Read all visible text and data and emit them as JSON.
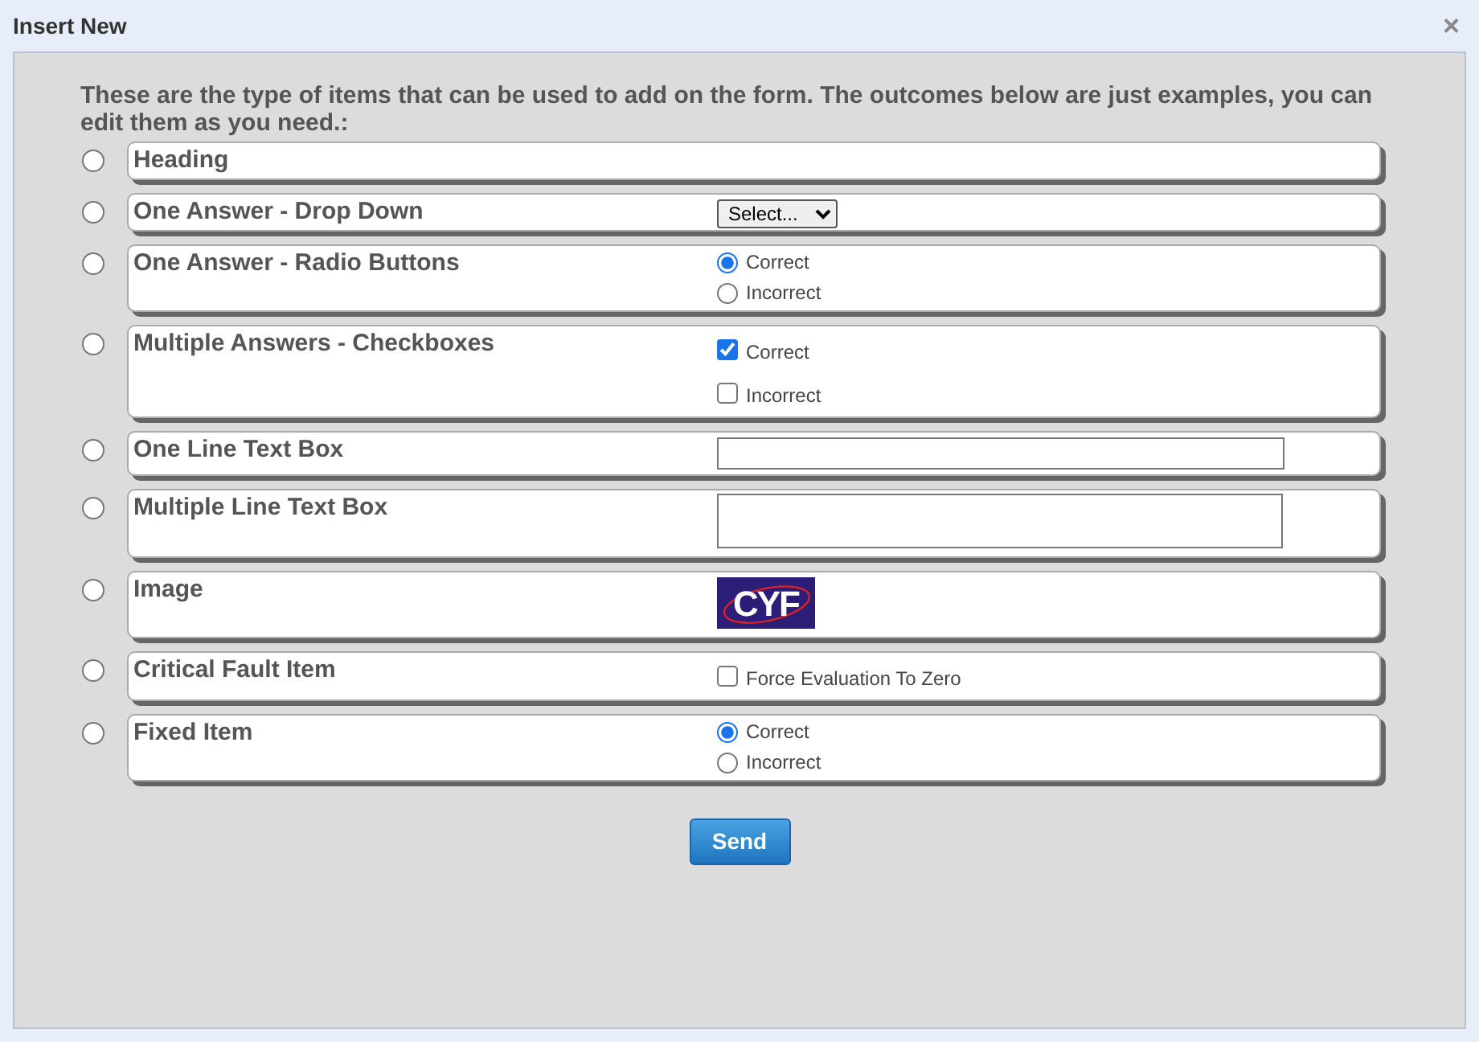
{
  "window": {
    "title": "Insert New",
    "close": "×"
  },
  "intro": "These are the type of items that can be used to add on the form. The outcomes below are just examples, you can edit them as you need.:",
  "items": [
    {
      "label": "Heading",
      "selected": false,
      "kind": "none"
    },
    {
      "label": "One Answer - Drop Down",
      "selected": false,
      "kind": "dropdown",
      "value": "Select..."
    },
    {
      "label": "One Answer - Radio Buttons",
      "selected": false,
      "kind": "radios",
      "options": [
        {
          "label": "Correct",
          "selected": true
        },
        {
          "label": "Incorrect",
          "selected": false
        }
      ]
    },
    {
      "label": "Multiple Answers - Checkboxes",
      "selected": false,
      "kind": "checkboxes",
      "options": [
        {
          "label": "Correct",
          "checked": true
        },
        {
          "label": "Incorrect",
          "checked": false
        }
      ]
    },
    {
      "label": "One Line Text Box",
      "selected": false,
      "kind": "textline"
    },
    {
      "label": "Multiple Line Text Box",
      "selected": false,
      "kind": "textarea"
    },
    {
      "label": "Image",
      "selected": false,
      "kind": "image",
      "logo": "CYF"
    },
    {
      "label": "Critical Fault Item",
      "selected": false,
      "kind": "checkboxes",
      "options": [
        {
          "label": "Force Evaluation To Zero",
          "checked": false
        }
      ]
    },
    {
      "label": "Fixed Item",
      "selected": false,
      "kind": "radios",
      "options": [
        {
          "label": "Correct",
          "selected": true
        },
        {
          "label": "Incorrect",
          "selected": false
        }
      ]
    }
  ],
  "send": "Send"
}
